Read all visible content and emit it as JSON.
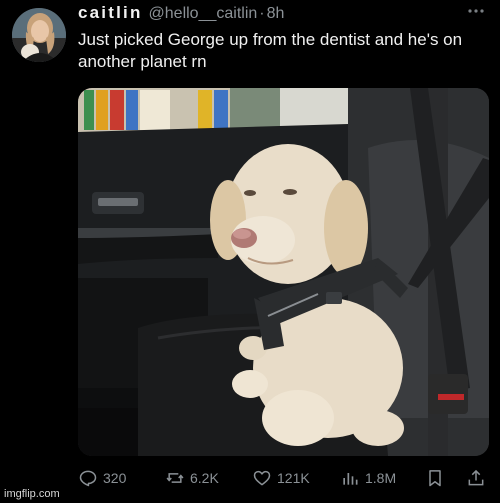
{
  "author": {
    "display_name": "caitlin",
    "handle": "@hello__caitlin",
    "separator": "·",
    "time": "8h"
  },
  "tweet": {
    "text": "Just picked George up from the dentist and he's on another planet rn"
  },
  "icons": {
    "avatar": "avatar-photo",
    "more": "more-icon",
    "reply": "reply-icon",
    "retweet": "retweet-icon",
    "like": "heart-icon",
    "views": "views-icon",
    "bookmark": "bookmark-icon",
    "share": "share-icon"
  },
  "stats": {
    "replies": "320",
    "retweets": "6.2K",
    "likes": "121K",
    "views": "1.8M"
  },
  "colors": {
    "background": "#000000",
    "text": "#e7e9ea",
    "secondary": "#8b9196"
  },
  "watermark": "imgflip.com"
}
